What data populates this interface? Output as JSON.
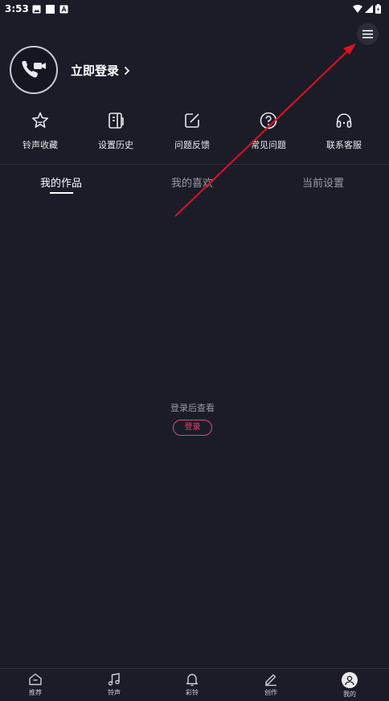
{
  "status_bar": {
    "time": "3:53"
  },
  "header": {
    "login_label": "立即登录"
  },
  "quick_actions": [
    {
      "label": "铃声收藏",
      "icon": "star-icon"
    },
    {
      "label": "设置历史",
      "icon": "history-icon"
    },
    {
      "label": "问题反馈",
      "icon": "feedback-icon"
    },
    {
      "label": "常见问题",
      "icon": "question-icon"
    },
    {
      "label": "联系客服",
      "icon": "headset-icon"
    }
  ],
  "tabs": [
    {
      "label": "我的作品",
      "active": true
    },
    {
      "label": "我的喜欢",
      "active": false
    },
    {
      "label": "当前设置",
      "active": false
    }
  ],
  "empty_state": {
    "message": "登录后查看",
    "button_label": "登录"
  },
  "bottom_nav": [
    {
      "label": "推荐",
      "icon": "home-icon"
    },
    {
      "label": "铃声",
      "icon": "music-note-icon"
    },
    {
      "label": "彩铃",
      "icon": "bell-icon"
    },
    {
      "label": "创作",
      "icon": "pen-icon"
    },
    {
      "label": "我的",
      "icon": "profile-icon"
    }
  ],
  "colors": {
    "background": "#1b1c28",
    "accent": "#e8456b",
    "annotation_arrow": "#e0121b"
  }
}
